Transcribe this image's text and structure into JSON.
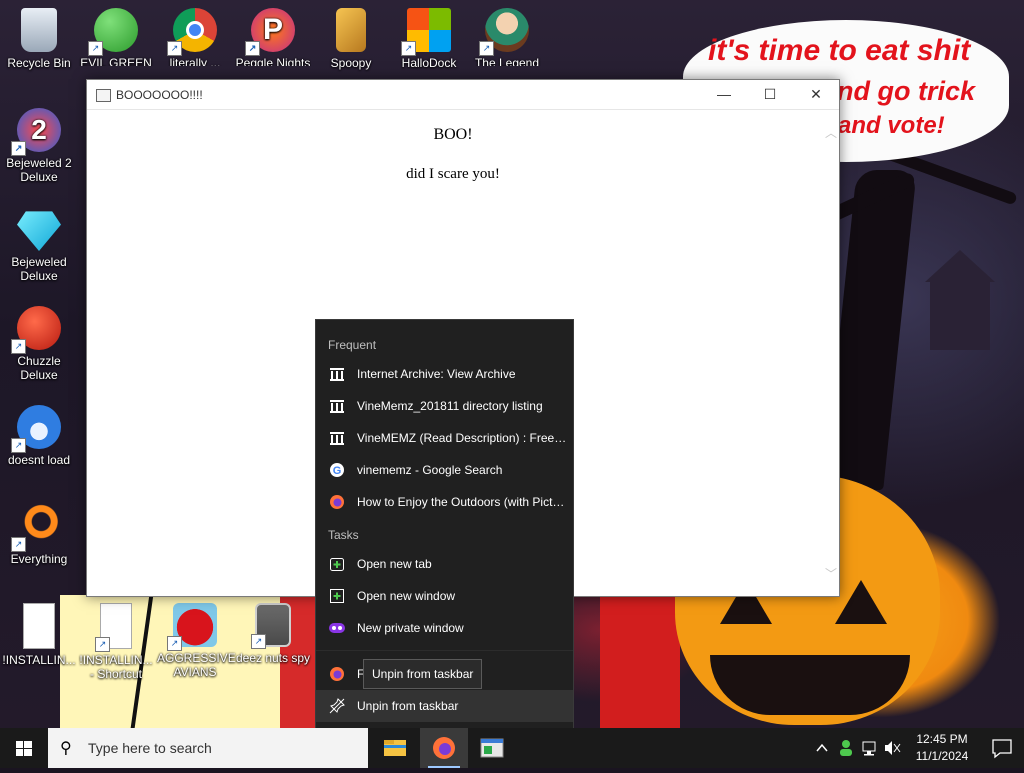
{
  "window": {
    "title": "BOOOOOOO!!!!",
    "heading": "BOO!",
    "text": "did I scare you!",
    "minimize_glyph": "—",
    "maximize_glyph": "☐",
    "close_glyph": "✕"
  },
  "wallpaper": {
    "bubble_lines": [
      "it's time to eat shit",
      "nd go trick",
      "and vote!"
    ]
  },
  "desktop_icons": [
    {
      "label": "Recycle Bin"
    },
    {
      "label": "EVIL GREEN MEN CO..."
    },
    {
      "label": "literally ..."
    },
    {
      "label": "Peggle Nights De..."
    },
    {
      "label": "Spoopy"
    },
    {
      "label": "HalloDock"
    },
    {
      "label": "The Legend of Tibb..."
    },
    {
      "label": "Bejeweled 2 Deluxe"
    },
    {
      "label": "Bejeweled Deluxe"
    },
    {
      "label": "Chuzzle Deluxe"
    },
    {
      "label": "doesnt load"
    },
    {
      "label": "Everything"
    },
    {
      "label": "!INSTALLIN..."
    },
    {
      "label": "!INSTALLIN... - Shortcut"
    },
    {
      "label": "AGGRESSIVE AVIANS"
    },
    {
      "label": "deez nuts spy"
    }
  ],
  "jumplist": {
    "frequent_header": "Frequent",
    "frequent": [
      {
        "label": "Internet Archive: View Archive",
        "icon": "archive-icon"
      },
      {
        "label": "VineMemz_201811 directory listing",
        "icon": "archive-icon"
      },
      {
        "label": "VineMEMZ (Read Description) : Free D...",
        "icon": "archive-icon"
      },
      {
        "label": "vinememz - Google Search",
        "icon": "google-icon"
      },
      {
        "label": "How to Enjoy the Outdoors (with Pictu...",
        "icon": "firefox-icon"
      }
    ],
    "tasks_header": "Tasks",
    "tasks": [
      {
        "label": "Open new tab",
        "icon": "new-tab-icon"
      },
      {
        "label": "Open new window",
        "icon": "new-window-icon"
      },
      {
        "label": "New private window",
        "icon": "private-window-icon"
      }
    ],
    "app_item": "Fi",
    "unpin_label": "Unpin from taskbar",
    "tooltip": "Unpin from taskbar"
  },
  "taskbar": {
    "search_placeholder": "Type here to search",
    "time": "12:45 PM",
    "date": "11/1/2024"
  },
  "colors": {
    "jumplist_bg": "#202020",
    "taskbar_bg": "#1a1a1a",
    "bubble_text": "#e3131c",
    "pumpkin": "#f39a13"
  }
}
